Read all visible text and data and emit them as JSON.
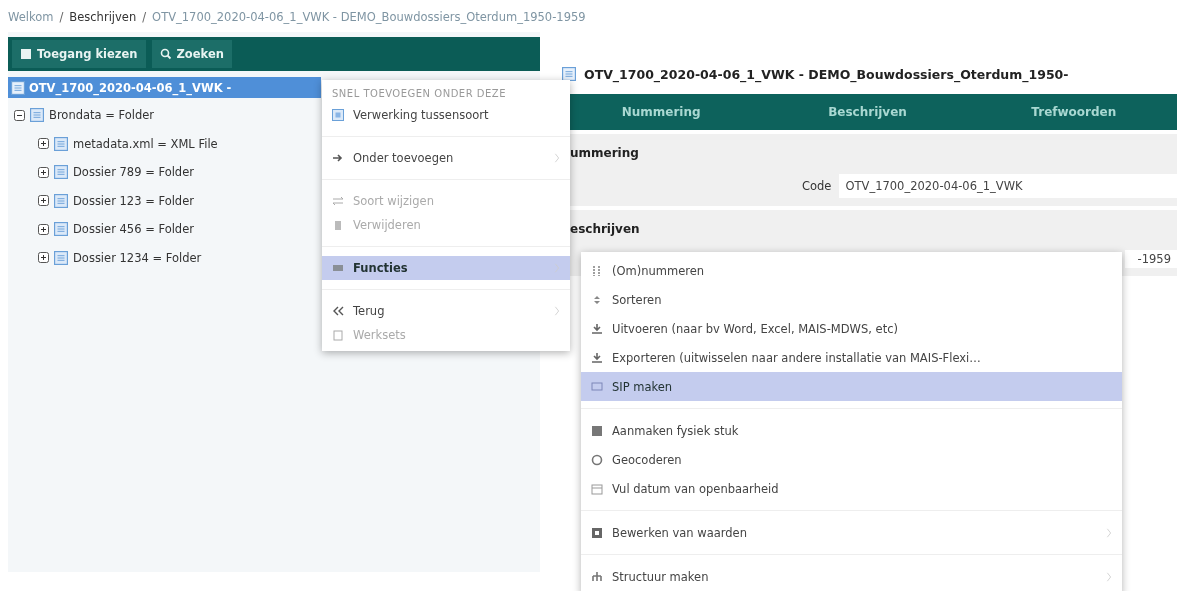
{
  "breadcrumb": [
    {
      "kind": "link",
      "label": "Welkom",
      "current": false
    },
    {
      "kind": "separator",
      "label": "/"
    },
    {
      "kind": "link",
      "label": "Beschrijven",
      "current": true
    },
    {
      "kind": "separator",
      "label": "/"
    },
    {
      "kind": "link",
      "label": "OTV_1700_2020-04-06_1_VWK - DEMO_Bouwdossiers_Oterdum_1950-1959",
      "current": false
    }
  ],
  "toolbar": {
    "buttons": [
      "Toegang kiezen",
      "Zoeken"
    ]
  },
  "tree": {
    "label": "OTV_1700_2020-04-06_1_VWK -",
    "selected": true,
    "children": [
      {
        "label": "Brondata = Folder",
        "expanded": true,
        "children": [
          {
            "label": "metadata.xml = XML File",
            "expanded": false
          },
          {
            "label": "Dossier 789 = Folder",
            "expanded": false
          },
          {
            "label": "Dossier 123 = Folder",
            "expanded": false
          },
          {
            "label": "Dossier 456 = Folder",
            "expanded": false
          },
          {
            "label": "Dossier 1234 = Folder",
            "expanded": false
          }
        ]
      }
    ]
  },
  "detail": {
    "title": "OTV_1700_2020-04-06_1_VWK - DEMO_Bouwdossiers_Oterdum_1950-",
    "tabs": [
      {
        "label": "Nummering",
        "selected": false
      },
      {
        "label": "Beschrijven",
        "selected": false
      },
      {
        "label": "Trefwoorden",
        "selected": false
      }
    ],
    "sections": [
      {
        "heading": "ummering",
        "field": {
          "label": "Code",
          "value": "OTV_1700_2020-04-06_1_VWK"
        }
      },
      {
        "heading": "eschrijven",
        "field": {
          "value": "-1959"
        }
      }
    ]
  },
  "context_menu": {
    "header": "SNEL TOEVOEGEN ONDER DEZE",
    "groups": [
      [
        {
          "label": "Verwerking tussensoort",
          "disabled": false,
          "selected": false,
          "submenu": false
        }
      ],
      [
        {
          "label": "Onder toevoegen",
          "disabled": false,
          "selected": false,
          "submenu": true
        }
      ],
      [
        {
          "label": "Soort wijzigen",
          "disabled": true,
          "selected": false,
          "submenu": false
        },
        {
          "label": "Verwijderen",
          "disabled": true,
          "selected": false,
          "submenu": false
        }
      ],
      [
        {
          "label": "Functies",
          "disabled": false,
          "selected": true,
          "submenu": true
        }
      ],
      [
        {
          "label": "Terug",
          "disabled": false,
          "selected": false,
          "submenu": true
        },
        {
          "label": "Werksets",
          "disabled": true,
          "selected": false,
          "submenu": false
        }
      ]
    ]
  },
  "submenu": {
    "groups": [
      [
        {
          "label": "(Om)nummeren",
          "selected": false,
          "submenu": false
        },
        {
          "label": "Sorteren",
          "selected": false,
          "submenu": false
        },
        {
          "label": "Uitvoeren (naar bv Word, Excel, MAIS-MDWS, etc)",
          "selected": false,
          "submenu": false
        },
        {
          "label": "Exporteren (uitwisselen naar andere installatie van MAIS-Flexi…",
          "selected": false,
          "submenu": false
        },
        {
          "label": "SIP maken",
          "selected": true,
          "submenu": false
        }
      ],
      [
        {
          "label": "Aanmaken fysiek stuk",
          "selected": false,
          "submenu": false
        },
        {
          "label": "Geocoderen",
          "selected": false,
          "submenu": false
        },
        {
          "label": "Vul datum van openbaarheid",
          "selected": false,
          "submenu": false
        }
      ],
      [
        {
          "label": "Bewerken van waarden",
          "selected": false,
          "submenu": true
        }
      ],
      [
        {
          "label": "Structuur maken",
          "selected": false,
          "submenu": true
        }
      ]
    ]
  }
}
